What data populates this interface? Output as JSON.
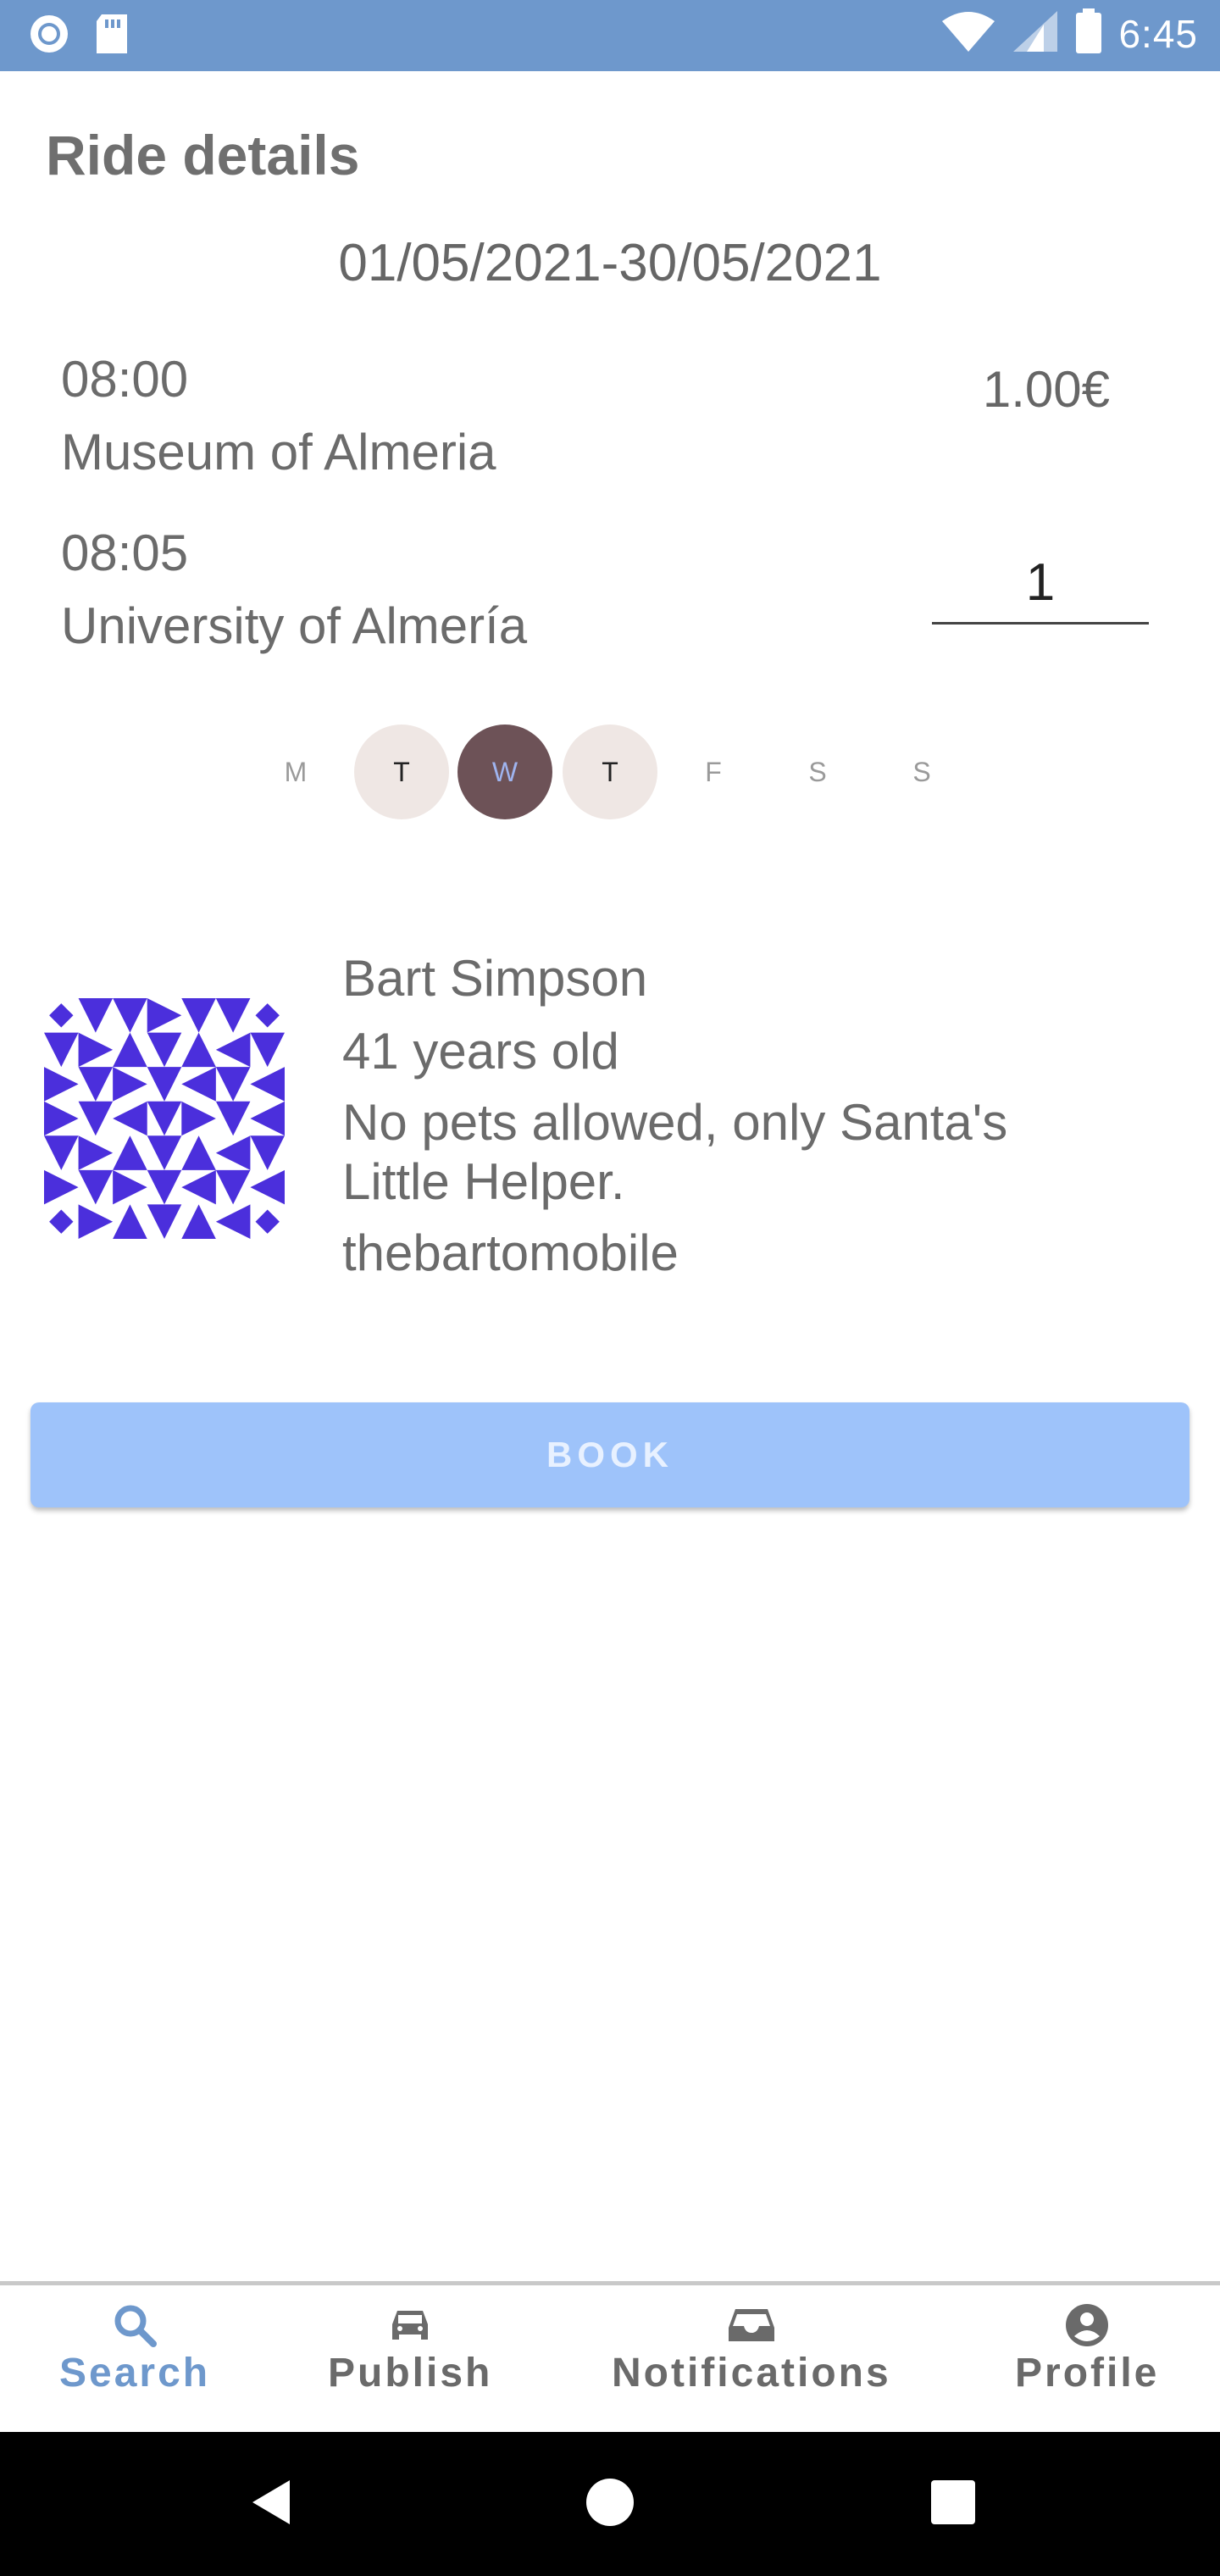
{
  "status_bar": {
    "time": "6:45",
    "icons": [
      "record-icon",
      "sd-card-icon",
      "wifi-icon",
      "signal-icon",
      "battery-icon"
    ],
    "color": "#6e98cc"
  },
  "page": {
    "title": "Ride details",
    "date_range": "01/05/2021-30/05/2021"
  },
  "ride": {
    "departure": {
      "time": "08:00",
      "place": "Museum of Almeria"
    },
    "arrival": {
      "time": "08:05",
      "place": "University of Almería"
    },
    "price": "1.00€",
    "seats_value": "1"
  },
  "days": [
    {
      "label": "M",
      "state": "off"
    },
    {
      "label": "T",
      "state": "available"
    },
    {
      "label": "W",
      "state": "selected"
    },
    {
      "label": "T",
      "state": "available"
    },
    {
      "label": "F",
      "state": "off"
    },
    {
      "label": "S",
      "state": "off"
    },
    {
      "label": "S",
      "state": "off"
    }
  ],
  "driver": {
    "name": "Bart Simpson",
    "age": "41 years old",
    "description": "No pets allowed, only Santa's Little Helper.",
    "car": "thebartomobile",
    "avatar_color": "#4b2fdc"
  },
  "actions": {
    "book_label": "BOOK",
    "book_color": "#9ec3fa"
  },
  "bottom_nav": {
    "items": [
      {
        "label": "Search",
        "icon": "search-icon",
        "active": true
      },
      {
        "label": "Publish",
        "icon": "car-icon",
        "active": false
      },
      {
        "label": "Notifications",
        "icon": "inbox-icon",
        "active": false
      },
      {
        "label": "Profile",
        "icon": "account-icon",
        "active": false
      }
    ],
    "active_color": "#6e98cc"
  }
}
